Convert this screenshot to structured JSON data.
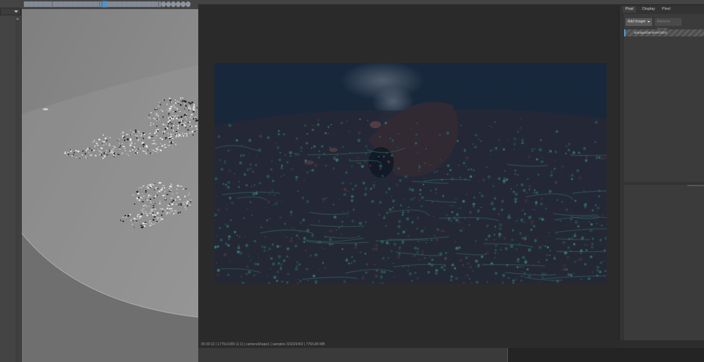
{
  "render_view": {
    "status_text": "00:30:12 | 1776x1000 (1:1) | cameraShape1 | samples 3/3/3/3/4/2 | 7765.84 MB"
  },
  "side_panel": {
    "tabs": [
      {
        "label": "Post"
      },
      {
        "label": "Display"
      },
      {
        "label": "Pixel"
      }
    ],
    "add_button_label": "Add Imager",
    "remove_button_label": "Remove Imager",
    "imager_item_label": "aiImagerDenoiserOidn1"
  },
  "colors": {
    "accent": "#5aa0d8",
    "render_background": "#1b2838",
    "viewport_background": "#8a8a8a"
  }
}
